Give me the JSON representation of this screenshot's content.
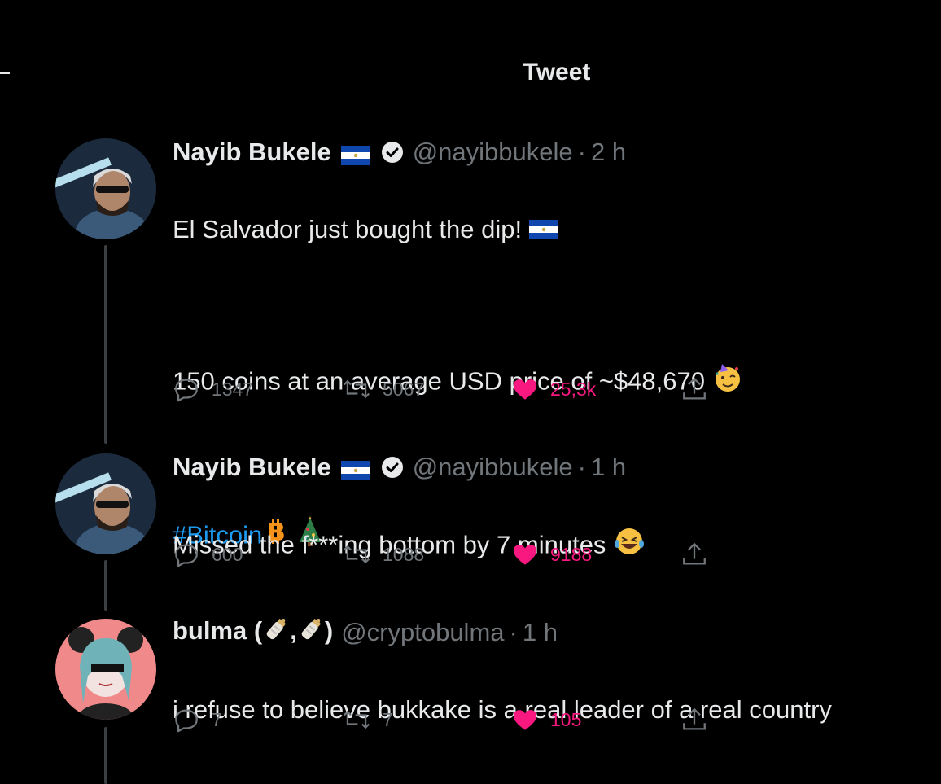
{
  "header": {
    "title": "Tweet"
  },
  "tweets": [
    {
      "name": "Nayib Bukele",
      "handle": "@nayibbukele",
      "time": "2 h",
      "lines": [
        "El Salvador just bought the dip! ",
        "",
        "150 coins at an average USD price of ~$48,670 "
      ],
      "hashtag": "#Bitcoin",
      "replies": "1347",
      "retweets": "5067",
      "likes": "25,3k"
    },
    {
      "name": "Nayib Bukele",
      "handle": "@nayibbukele",
      "time": "1 h",
      "text": "Missed the f***ing bottom by 7 minutes ",
      "replies": "600",
      "retweets": "1088",
      "likes": "9188"
    },
    {
      "name": "bulma (",
      "name_mid": ",",
      "name_end": ")",
      "handle": "@cryptobulma",
      "time": "1 h",
      "text": "i refuse to believe bukkake is a real leader of a real country",
      "replies": "7",
      "retweets": "7",
      "likes": "105"
    }
  ],
  "colors": {
    "accent": "#1d9bf0",
    "like": "#f91880",
    "muted": "#71767b",
    "text": "#e7e9ea"
  },
  "icons": [
    "reply-icon",
    "retweet-icon",
    "heart-icon",
    "share-icon",
    "verified-icon",
    "flag-el-salvador-icon",
    "bitcoin-icon",
    "christmas-tree-icon",
    "partying-face-icon",
    "laughing-face-icon",
    "baby-bottle-icon"
  ]
}
